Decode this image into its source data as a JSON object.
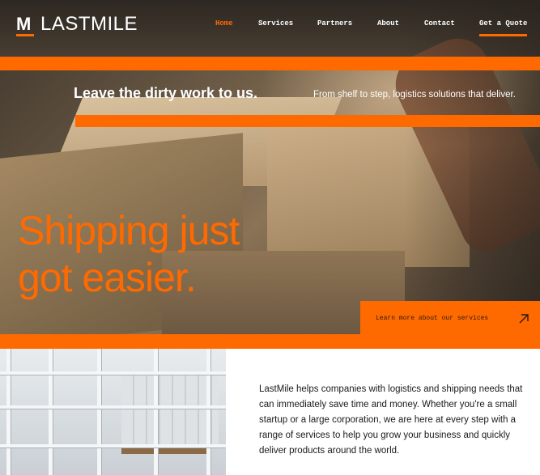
{
  "brand": {
    "logo_mark": "M",
    "name": "LASTMILE"
  },
  "nav": {
    "items": [
      {
        "label": "Home"
      },
      {
        "label": "Services"
      },
      {
        "label": "Partners"
      },
      {
        "label": "About"
      },
      {
        "label": "Contact"
      },
      {
        "label": "Get a Quote"
      }
    ],
    "active": "Home"
  },
  "hero": {
    "tagline": "Leave the dirty work to us.",
    "subline": "From shelf to step, logistics solutions that deliver.",
    "headline_line1": "Shipping just",
    "headline_line2": "got easier.",
    "cta_text": "Learn more about our services",
    "cta_icon": "arrow-up-right-icon"
  },
  "about": {
    "text": "LastMile helps companies with logistics and shipping needs that can immediately save time and money. Whether you're a small startup or a large corporation, we are here at every step with a range of services to help you grow your business and quickly deliver products around the world."
  },
  "colors": {
    "accent": "#ff6a00",
    "text_dark": "#1a1a1a",
    "white": "#ffffff"
  }
}
